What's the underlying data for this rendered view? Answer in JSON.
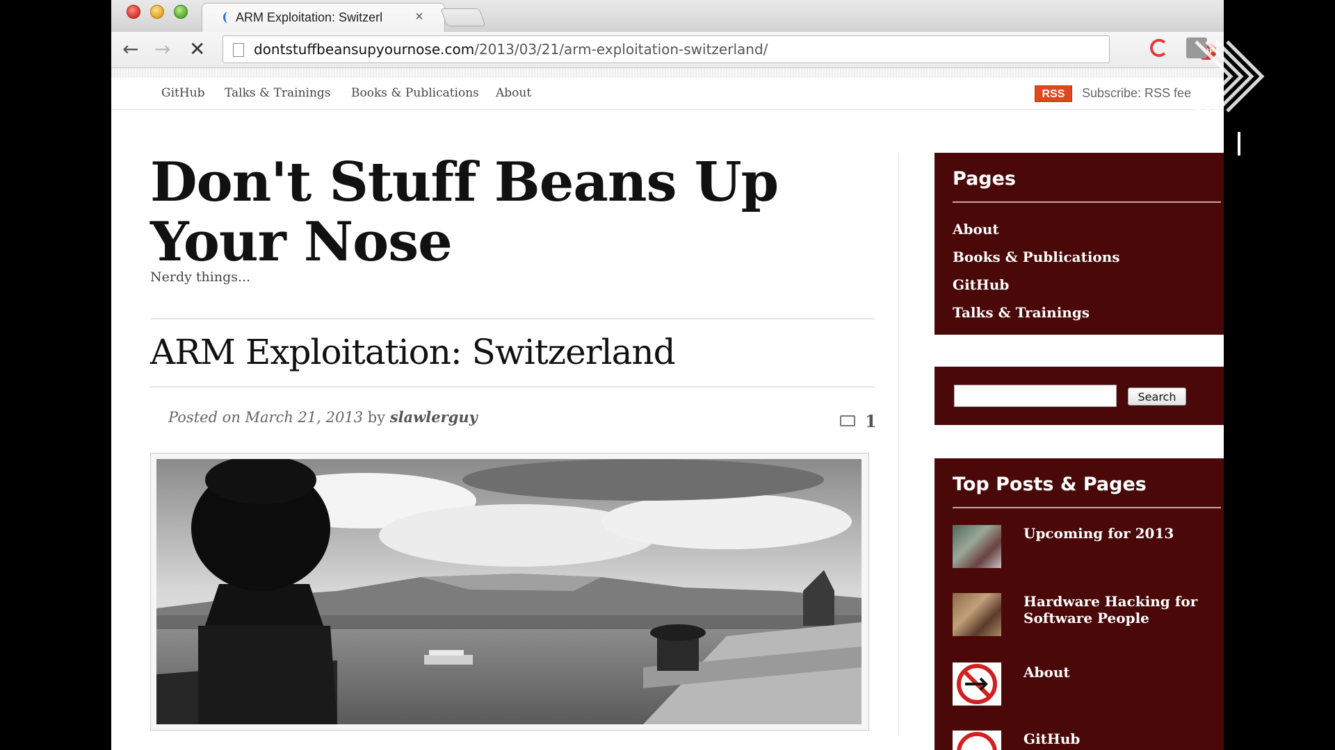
{
  "browser": {
    "tab_title": "ARM Exploitation: Switzerl",
    "tab_close": "×",
    "url_host": "dontstuffbeansupyournose.com",
    "url_path": "/2013/03/21/arm-exploitation-switzerland/",
    "adblock_label": "ABP"
  },
  "site_nav": {
    "items": [
      "GitHub",
      "Talks & Trainings",
      "Books & Publications",
      "About"
    ],
    "rss_label": "RSS",
    "subscribe_text": "Subscribe:  RSS fee"
  },
  "site": {
    "title": "Don't Stuff Beans Up Your Nose",
    "tagline": "Nerdy things..."
  },
  "post": {
    "title": "ARM Exploitation: Switzerland",
    "meta_prefix": "Posted on ",
    "date": "March 21, 2013",
    "meta_by": " by ",
    "author": "slawlerguy",
    "comment_count": "1"
  },
  "sidebar": {
    "pages_heading": "Pages",
    "pages": [
      "About",
      "Books & Publications",
      "GitHub",
      "Talks & Trainings"
    ],
    "search_button": "Search",
    "top_heading": "Top Posts & Pages",
    "top_posts": [
      "Upcoming for 2013",
      "Hardware Hacking for Software People",
      "About",
      "GitHub"
    ]
  },
  "colors": {
    "sidebar_bg": "#4a0808",
    "rss_orange": "#e0471c"
  }
}
